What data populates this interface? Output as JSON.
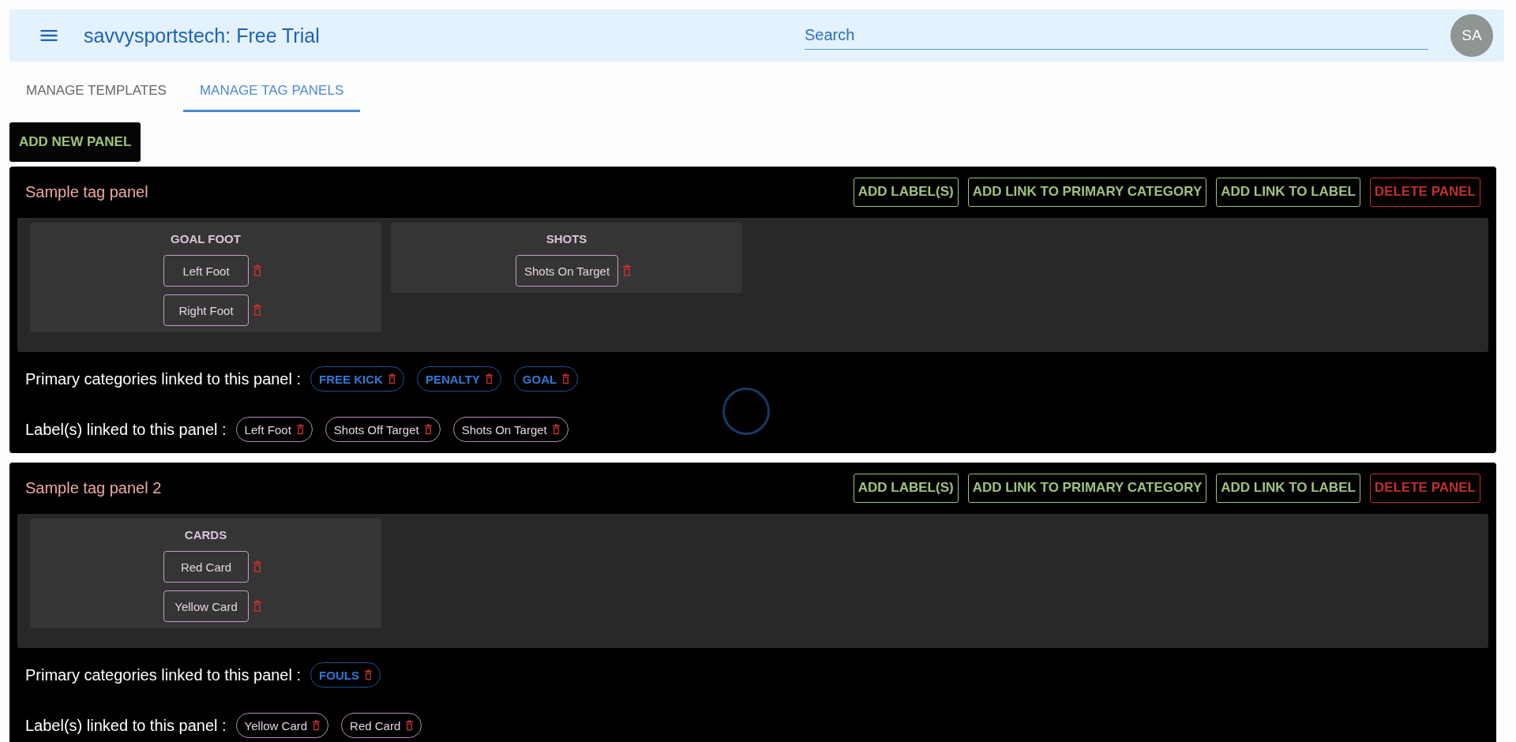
{
  "app_bar": {
    "title": "savvysportstech: Free Trial",
    "search": {
      "placeholder": "Search"
    },
    "avatar": "SA"
  },
  "tabs": [
    {
      "label": "MANAGE TEMPLATES",
      "selected": false
    },
    {
      "label": "MANAGE TAG PANELS",
      "selected": true
    }
  ],
  "add_panel_button": "ADD NEW PANEL",
  "panels": [
    {
      "title": "Sample tag panel",
      "actions": [
        {
          "label": "ADD LABEL(S)",
          "kind": "add"
        },
        {
          "label": "ADD LINK TO PRIMARY CATEGORY",
          "kind": "add"
        },
        {
          "label": "ADD LINK TO LABEL",
          "kind": "add"
        },
        {
          "label": "DELETE PANEL",
          "kind": "delete"
        }
      ],
      "groups": [
        {
          "name": "GOAL FOOT",
          "labels": [
            "Left Foot",
            "Right Foot"
          ]
        },
        {
          "name": "SHOTS",
          "labels": [
            "Shots On Target"
          ]
        }
      ],
      "primary_caption": "Primary categories linked to this panel :",
      "primary_categories": [
        "FREE KICK",
        "PENALTY",
        "GOAL"
      ],
      "labels_caption": "Label(s) linked to this panel :",
      "linked_labels": [
        "Left Foot",
        "Shots Off Target",
        "Shots On Target"
      ]
    },
    {
      "title": "Sample tag panel 2",
      "actions": [
        {
          "label": "ADD LABEL(S)",
          "kind": "add"
        },
        {
          "label": "ADD LINK TO PRIMARY CATEGORY",
          "kind": "add"
        },
        {
          "label": "ADD LINK TO LABEL",
          "kind": "add"
        },
        {
          "label": "DELETE PANEL",
          "kind": "delete"
        }
      ],
      "groups": [
        {
          "name": "CARDS",
          "labels": [
            "Red Card",
            "Yellow Card"
          ]
        }
      ],
      "primary_caption": "Primary categories linked to this panel :",
      "primary_categories": [
        "FOULS"
      ],
      "labels_caption": "Label(s) linked to this panel :",
      "linked_labels": [
        "Yellow Card",
        "Red Card"
      ]
    }
  ]
}
